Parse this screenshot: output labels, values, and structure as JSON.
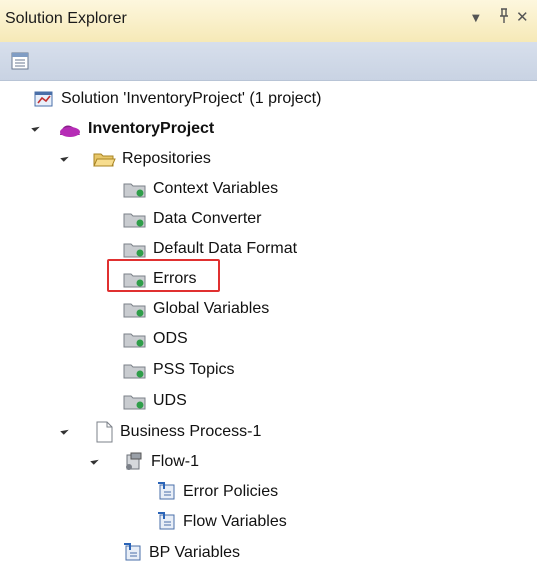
{
  "window": {
    "title": "Solution Explorer"
  },
  "title_buttons": {
    "dropdown": "▼",
    "pin": "ᵻ",
    "close": "✕"
  },
  "tree": {
    "solution": "Solution 'InventoryProject' (1 project)",
    "project": "InventoryProject",
    "repositories": "Repositories",
    "repo_items": [
      "Context Variables",
      "Data Converter",
      "Default Data Format",
      "Errors",
      "Global Variables",
      "ODS",
      "PSS Topics",
      "UDS"
    ],
    "business_process": "Business Process-1",
    "flow": "Flow-1",
    "flow_items": [
      "Error Policies",
      "Flow Variables"
    ],
    "bp_variables": "BP Variables"
  },
  "colors": {
    "highlight": "#e03030",
    "title_bg": "#f6e9b7",
    "toolbar_bg": "#cfd8e8"
  }
}
